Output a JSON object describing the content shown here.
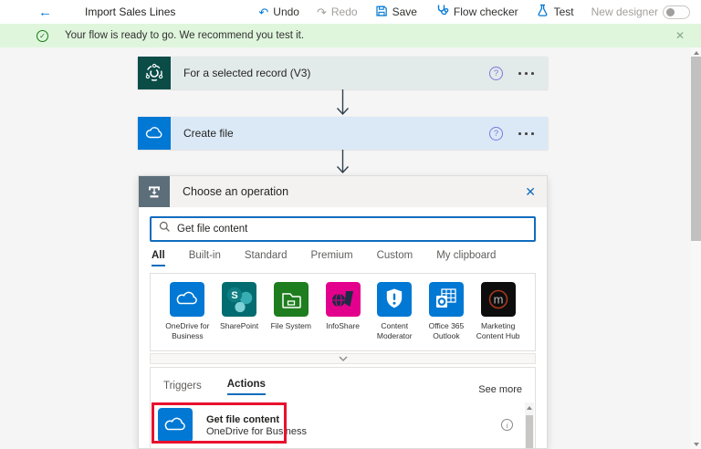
{
  "topbar": {
    "title": "Import Sales Lines",
    "undo_label": "Undo",
    "redo_label": "Redo",
    "save_label": "Save",
    "flow_checker_label": "Flow checker",
    "test_label": "Test",
    "new_designer_label": "New designer",
    "new_designer_state": "off"
  },
  "notification": {
    "message": "Your flow is ready to go. We recommend you test it."
  },
  "flow": {
    "steps": [
      {
        "title": "For a selected record (V3)"
      },
      {
        "title": "Create file"
      }
    ]
  },
  "panel": {
    "title": "Choose an operation",
    "search_value": "Get file content",
    "tabs": [
      "All",
      "Built-in",
      "Standard",
      "Premium",
      "Custom",
      "My clipboard"
    ],
    "selected_tab": "All",
    "connectors": [
      "OneDrive for Business",
      "SharePoint",
      "File System",
      "InfoShare",
      "Content Moderator",
      "Office 365 Outlook",
      "Marketing Content Hub"
    ],
    "list_tabs": {
      "triggers": "Triggers",
      "actions": "Actions"
    },
    "selected_list_tab": "Actions",
    "see_more": "See more",
    "results": [
      {
        "title": "Get file content",
        "subtitle": "OneDrive for Business"
      }
    ]
  },
  "icons": {
    "back": "←",
    "undo": "↶",
    "redo": "↷",
    "close": "✕",
    "help": "?",
    "check": "✓",
    "info": "i"
  },
  "colors": {
    "accent": "#0078D4",
    "search_border": "#0F6CBD",
    "notification_bg": "#DFF6DD",
    "notification_green": "#107C10",
    "annotation_red": "#E8112D",
    "dataverse_teal": "#0B4C47",
    "card1_bg": "#E3EAEA",
    "card2_bg": "#DBE9F7",
    "panel_header_icon_bg": "#5C6E79",
    "sharepoint_teal": "#036C70",
    "filesystem_green": "#1E7D1E",
    "infoshare_magenta": "#E3008C",
    "marketing_black": "#0D0D0D",
    "help_purple": "#7B79DC"
  }
}
